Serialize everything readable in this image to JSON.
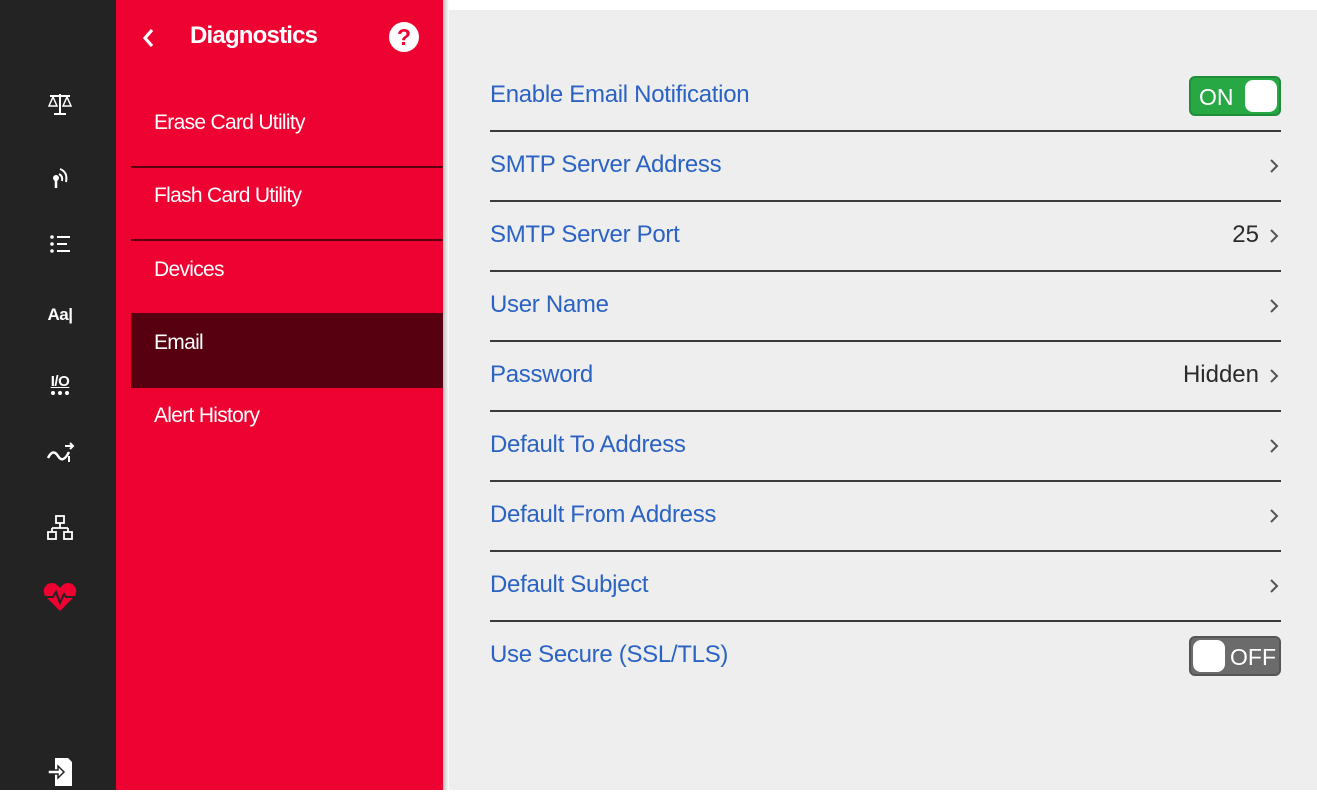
{
  "header": {
    "title": "Diagnostics",
    "help_symbol": "?"
  },
  "rail": {
    "icons": [
      "scale-icon",
      "wireless-signal-icon",
      "list-icon",
      "text-format-icon",
      "io-icon",
      "signal-wave-icon",
      "network-tree-icon",
      "heart-pulse-icon",
      "file-export-icon"
    ],
    "text_format_label": "Aa|",
    "io_label": "I/O",
    "active_color": "#ee0231"
  },
  "menu": {
    "items": [
      {
        "label": "Erase Card Utility"
      },
      {
        "label": "Flash Card Utility"
      },
      {
        "label": "Devices"
      },
      {
        "label": "Email",
        "active": true
      },
      {
        "label": "Alert History"
      }
    ]
  },
  "settings": {
    "rows": [
      {
        "label": "Enable Email Notification",
        "control": "toggle",
        "state": "ON"
      },
      {
        "label": "SMTP Server Address",
        "control": "chevron",
        "value": ""
      },
      {
        "label": "SMTP Server Port",
        "control": "chevron",
        "value": "25"
      },
      {
        "label": "User Name",
        "control": "chevron",
        "value": ""
      },
      {
        "label": "Password",
        "control": "chevron",
        "value": "Hidden"
      },
      {
        "label": "Default To Address",
        "control": "chevron",
        "value": ""
      },
      {
        "label": "Default From Address",
        "control": "chevron",
        "value": ""
      },
      {
        "label": "Default Subject",
        "control": "chevron",
        "value": ""
      },
      {
        "label": "Use Secure (SSL/TLS)",
        "control": "toggle",
        "state": "OFF"
      }
    ]
  },
  "colors": {
    "menu_red": "#ee0231",
    "active_item": "#560010",
    "label_blue": "#2a63c4",
    "toggle_on": "#27a844",
    "toggle_off": "#6b6b6b"
  }
}
